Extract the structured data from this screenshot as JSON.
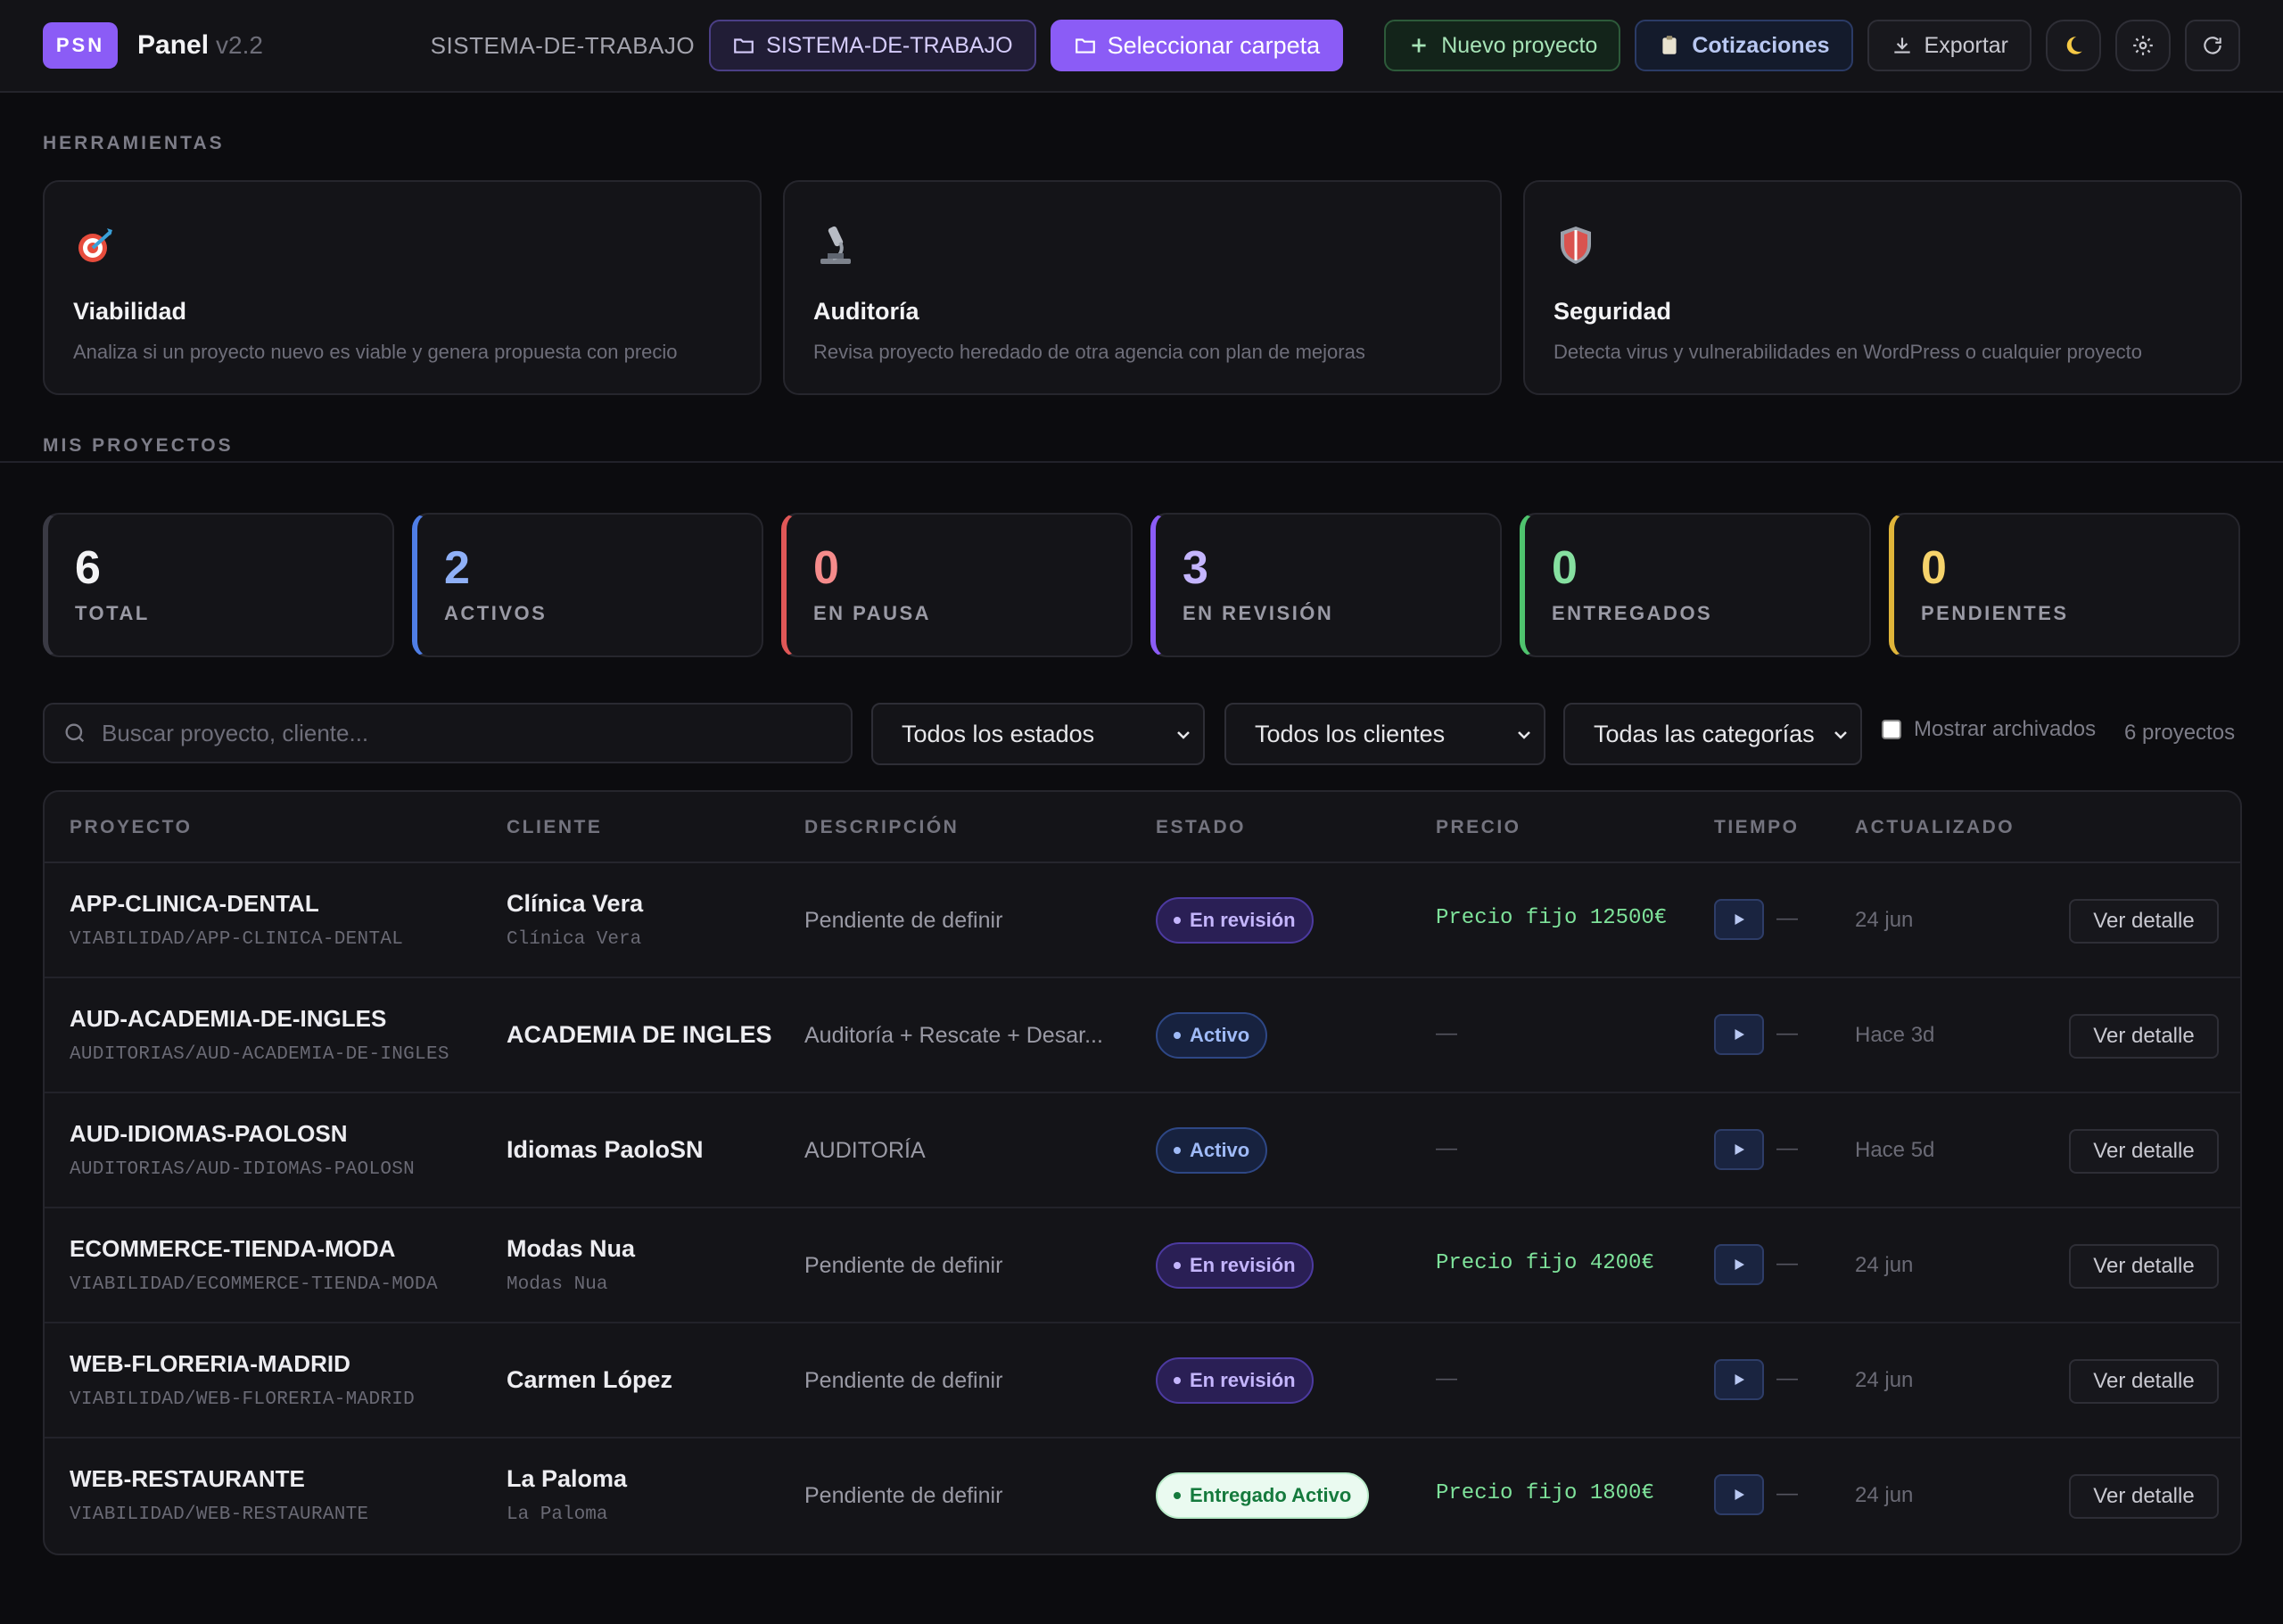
{
  "header": {
    "logo": "PSN",
    "title": "Panel",
    "version": "v2.2",
    "workspace_label": "SISTEMA-DE-TRABAJO",
    "workspace_button": "SISTEMA-DE-TRABAJO",
    "select_folder": "Seleccionar carpeta",
    "new_project": "Nuevo proyecto",
    "quotes": "Cotizaciones",
    "export": "Exportar"
  },
  "tools": {
    "section": "HERRAMIENTAS",
    "items": [
      {
        "icon": "target-icon",
        "title": "Viabilidad",
        "desc": "Analiza si un proyecto nuevo es viable y genera propuesta con precio"
      },
      {
        "icon": "microscope-icon",
        "title": "Auditoría",
        "desc": "Revisa proyecto heredado de otra agencia con plan de mejoras"
      },
      {
        "icon": "shield-icon",
        "title": "Seguridad",
        "desc": "Detecta virus y vulnerabilidades en WordPress o cualquier proyecto"
      }
    ]
  },
  "projects": {
    "section": "MIS PROYECTOS",
    "stats": [
      {
        "value": "6",
        "label": "TOTAL",
        "color": "#f3f3f5",
        "border": "#3a3a44"
      },
      {
        "value": "2",
        "label": "ACTIVOS",
        "color": "#8fb0f7",
        "border": "#4f7ee6"
      },
      {
        "value": "0",
        "label": "EN PAUSA",
        "color": "#f58b8b",
        "border": "#e05757"
      },
      {
        "value": "3",
        "label": "EN REVISIÓN",
        "color": "#c4b5fd",
        "border": "#8b5cf6"
      },
      {
        "value": "0",
        "label": "ENTREGADOS",
        "color": "#86e0a0",
        "border": "#4fc46e"
      },
      {
        "value": "0",
        "label": "PENDIENTES",
        "color": "#f6d36b",
        "border": "#e0b53a"
      }
    ]
  },
  "filters": {
    "search_placeholder": "Buscar proyecto, cliente...",
    "status": "Todos los estados",
    "clients": "Todos los clientes",
    "categories": "Todas las categorías",
    "archived": "Mostrar archivados",
    "count": "6 proyectos"
  },
  "table": {
    "headers": [
      "PROYECTO",
      "CLIENTE",
      "DESCRIPCIÓN",
      "ESTADO",
      "PRECIO",
      "TIEMPO",
      "ACTUALIZADO"
    ],
    "rows": [
      {
        "name": "APP-CLINICA-DENTAL",
        "path": "VIABILIDAD/APP-CLINICA-DENTAL",
        "client": "Clínica Vera",
        "client_sub": "Clínica Vera",
        "desc": "Pendiente de definir",
        "status": "En revisión",
        "status_type": "review",
        "price": "Precio fijo 12500€",
        "time": "—",
        "updated": "24 jun",
        "action": "Ver detalle"
      },
      {
        "name": "AUD-ACADEMIA-DE-INGLES",
        "path": "AUDITORIAS/AUD-ACADEMIA-DE-INGLES",
        "client": "ACADEMIA DE INGLES",
        "client_sub": "",
        "desc": "Auditoría + Rescate + Desar...",
        "status": "Activo",
        "status_type": "active",
        "price": "—",
        "time": "—",
        "updated": "Hace 3d",
        "action": "Ver detalle"
      },
      {
        "name": "AUD-IDIOMAS-PAOLOSN",
        "path": "AUDITORIAS/AUD-IDIOMAS-PAOLOSN",
        "client": "Idiomas PaoloSN",
        "client_sub": "",
        "desc": "AUDITORÍA",
        "status": "Activo",
        "status_type": "active",
        "price": "—",
        "time": "—",
        "updated": "Hace 5d",
        "action": "Ver detalle"
      },
      {
        "name": "ECOMMERCE-TIENDA-MODA",
        "path": "VIABILIDAD/ECOMMERCE-TIENDA-MODA",
        "client": "Modas Nua",
        "client_sub": "Modas Nua",
        "desc": "Pendiente de definir",
        "status": "En revisión",
        "status_type": "review",
        "price": "Precio fijo 4200€",
        "time": "—",
        "updated": "24 jun",
        "action": "Ver detalle"
      },
      {
        "name": "WEB-FLORERIA-MADRID",
        "path": "VIABILIDAD/WEB-FLORERIA-MADRID",
        "client": "Carmen López",
        "client_sub": "",
        "desc": "Pendiente de definir",
        "status": "En revisión",
        "status_type": "review",
        "price": "—",
        "time": "—",
        "updated": "24 jun",
        "action": "Ver detalle"
      },
      {
        "name": "WEB-RESTAURANTE",
        "path": "VIABILIDAD/WEB-RESTAURANTE",
        "client": "La Paloma",
        "client_sub": "La Paloma",
        "desc": "Pendiente de definir",
        "status": "Entregado Activo",
        "status_type": "delivered",
        "price": "Precio fijo 1800€",
        "time": "—",
        "updated": "24 jun",
        "action": "Ver detalle"
      }
    ]
  }
}
